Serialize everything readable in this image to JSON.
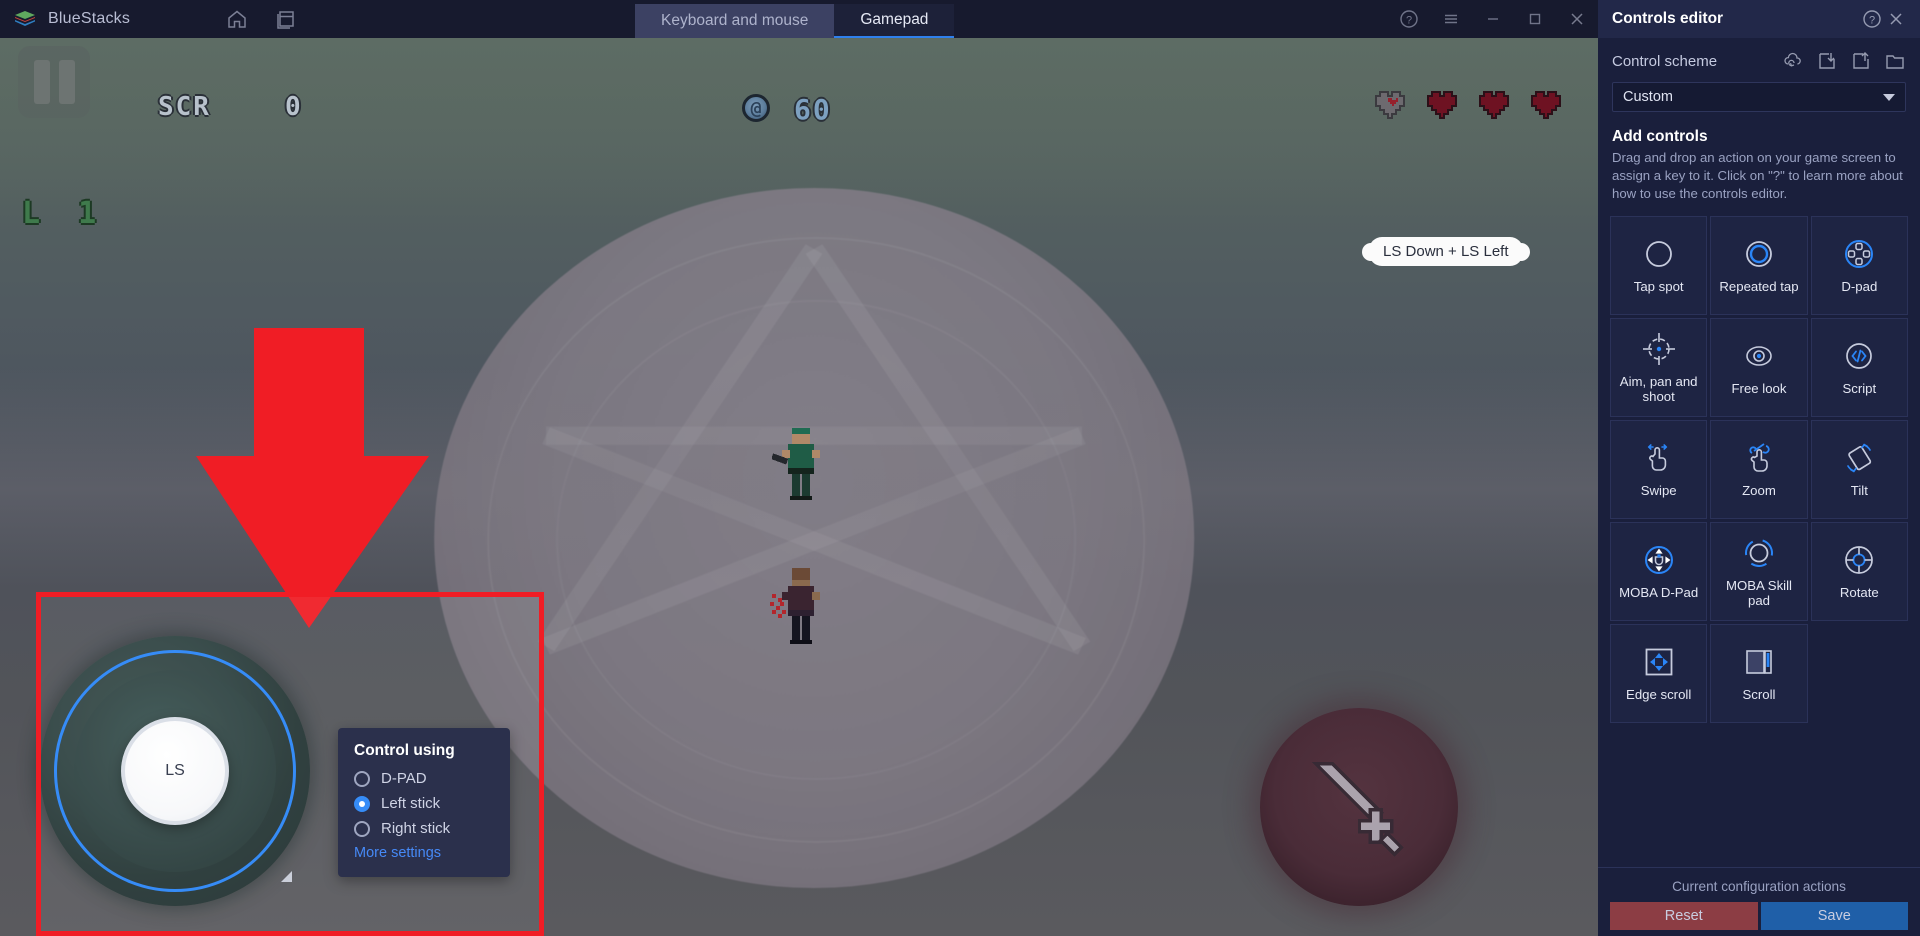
{
  "titlebar": {
    "app_name": "BlueStacks",
    "logo_icon": "bluestacks-logo-icon",
    "home_icon": "home-icon",
    "multi_instance_icon": "multi-instance-icon",
    "tabs": [
      {
        "label": "Keyboard and mouse",
        "active": false
      },
      {
        "label": "Gamepad",
        "active": true
      }
    ],
    "window_controls": [
      {
        "name": "help-icon",
        "glyph": "?"
      },
      {
        "name": "menu-icon",
        "glyph": "≡"
      },
      {
        "name": "minimize-icon",
        "glyph": "−"
      },
      {
        "name": "maximize-icon",
        "glyph": "□"
      },
      {
        "name": "close-icon",
        "glyph": "✕"
      }
    ]
  },
  "game_hud": {
    "pause_label": "pause",
    "score_caption": "SCR",
    "score_value": "0",
    "level_label": "L 1",
    "coin_icon": "coin-icon",
    "coin_count": "60",
    "hearts": [
      {
        "state": "empty"
      },
      {
        "state": "full"
      },
      {
        "state": "full"
      },
      {
        "state": "full"
      }
    ],
    "attack_button_icon": "sword-icon"
  },
  "annotations": {
    "tooltip_text": "LS Down + LS Left",
    "highlight_color": "#f01d25",
    "arrow_color": "#f01d25",
    "arrow_direction": "down"
  },
  "joystick": {
    "knob_label": "LS",
    "ring_color": "#2a85f7",
    "resize_handle": "resize-handle-icon"
  },
  "control_using_popup": {
    "title": "Control using",
    "options": [
      {
        "label": "D-PAD",
        "selected": false
      },
      {
        "label": "Left stick",
        "selected": true
      },
      {
        "label": "Right stick",
        "selected": false
      }
    ],
    "more_settings_label": "More settings",
    "link_color": "#3b82f6"
  },
  "panel": {
    "title": "Controls editor",
    "help_icon": "help-circle-icon",
    "close_icon": "close-icon",
    "scheme": {
      "label": "Control scheme",
      "icons": [
        "cloud-sync-icon",
        "import-icon",
        "export-icon",
        "folder-icon"
      ],
      "selected": "Custom",
      "caret_icon": "chevron-down-icon"
    },
    "add_controls": {
      "title": "Add controls",
      "description": "Drag and drop an action on your game screen to assign a key to it. Click on \"?\" to learn more about how to use the controls editor."
    },
    "tiles": [
      {
        "label": "Tap spot",
        "icon": "tap-spot-icon"
      },
      {
        "label": "Repeated tap",
        "icon": "repeated-tap-icon"
      },
      {
        "label": "D-pad",
        "icon": "d-pad-icon"
      },
      {
        "label": "Aim, pan and shoot",
        "icon": "aim-pan-shoot-icon"
      },
      {
        "label": "Free look",
        "icon": "free-look-icon"
      },
      {
        "label": "Script",
        "icon": "script-icon"
      },
      {
        "label": "Swipe",
        "icon": "swipe-icon"
      },
      {
        "label": "Zoom",
        "icon": "zoom-icon"
      },
      {
        "label": "Tilt",
        "icon": "tilt-icon"
      },
      {
        "label": "MOBA D-Pad",
        "icon": "moba-d-pad-icon"
      },
      {
        "label": "MOBA Skill pad",
        "icon": "moba-skill-pad-icon"
      },
      {
        "label": "Rotate",
        "icon": "rotate-icon"
      },
      {
        "label": "Edge scroll",
        "icon": "edge-scroll-icon"
      },
      {
        "label": "Scroll",
        "icon": "scroll-icon"
      }
    ],
    "footer": {
      "caption": "Current configuration actions",
      "reset_label": "Reset",
      "save_label": "Save",
      "reset_color": "#8c3d44",
      "save_color": "#1f5fa8"
    }
  }
}
